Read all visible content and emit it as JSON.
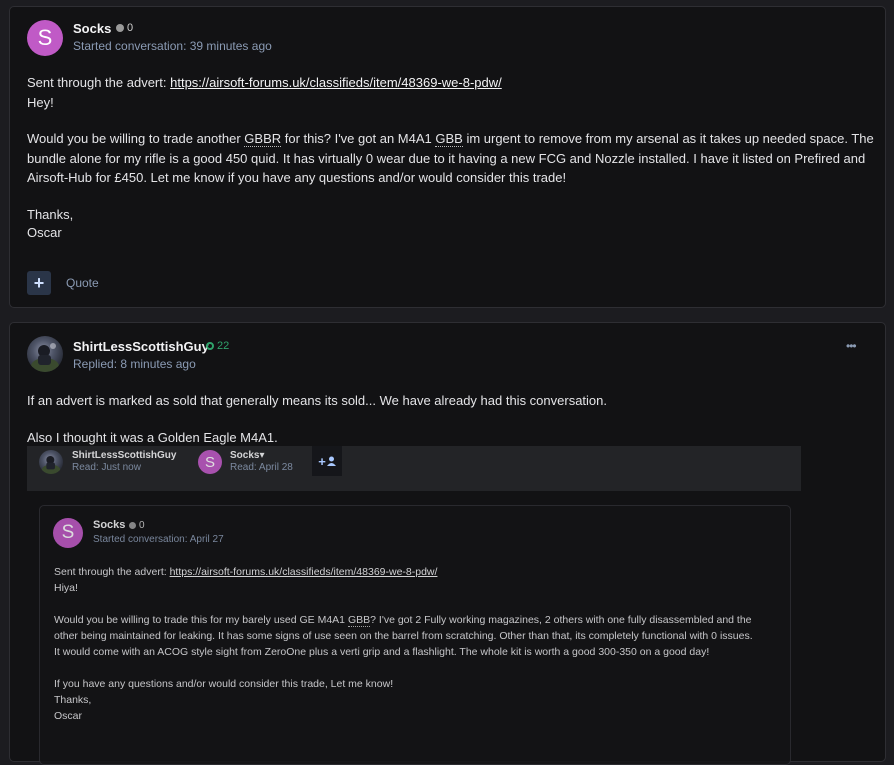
{
  "message1": {
    "author": "Socks",
    "avatar_letter": "S",
    "reputation": "0",
    "meta": "Started conversation: 39 minutes ago",
    "advert_prefix": "Sent through the advert: ",
    "advert_link": "https://airsoft-forums.uk/classifieds/item/48369-we-8-pdw/",
    "greeting": "Hey!",
    "p1_a": "Would you be willing to trade another ",
    "p1_gbbr": "GBBR",
    "p1_b": " for this? I've got an M4A1 ",
    "p1_gbb": "GBB",
    "p1_c": " im urgent to remove from my arsenal as it takes up needed space. The",
    "p1_line2": "bundle alone for my rifle is a good 450 quid. It has virtually 0 wear due to it having a new FCG and Nozzle installed. I have it listed on Prefired and",
    "p1_line3": "Airsoft-Hub for £450. Let me know if you have any questions and/or would consider this trade!",
    "thanks": "Thanks,",
    "sign": "Oscar",
    "plus_label": "+",
    "quote_label": "Quote"
  },
  "message2": {
    "author": "ShirtLessScottishGuy",
    "reputation": "22",
    "meta": "Replied: 8 minutes ago",
    "line1": "If an advert is marked as sold that generally means its sold... We have already had this conversation.",
    "line2": "Also I thought it was a Golden Eagle M4A1.",
    "more_label": "•••"
  },
  "read_receipts": {
    "user1_name": "ShirtLessScottishGuy",
    "user1_status": "Read: Just now",
    "user2_letter": "S",
    "user2_name": "Socks",
    "user2_caret": "▾",
    "user2_status": "Read: April 28",
    "add_label": "+"
  },
  "quoted": {
    "author": "Socks",
    "avatar_letter": "S",
    "reputation": "0",
    "meta": "Started conversation: April 27",
    "advert_prefix": "Sent through the advert: ",
    "advert_link": "https://airsoft-forums.uk/classifieds/item/48369-we-8-pdw/",
    "greeting": "Hiya!",
    "p1_a": "Would you be willing to trade this for my barely used GE M4A1 ",
    "p1_gbb": "GBB",
    "p1_b": "? I've got 2 Fully working magazines, 2 others with one fully disassembled and the",
    "p1_line2": "other being maintained for leaking. It has some signs of use seen on the barrel from scratching. Other than that, its completely functional with 0 issues.",
    "p1_line3": "It would come with an ACOG style sight from ZeroOne plus a verti grip and a flashlight. The whole kit is worth a good 300-350 on a good day!",
    "p2": "If you have any questions and/or would consider this trade, Let me know!",
    "thanks": "Thanks,",
    "sign": "Oscar"
  },
  "colors": {
    "avatar_purple": "#c05ac6",
    "meta_blue": "#8b9bb4",
    "rep_green": "#2fa36b",
    "rep_grey": "#9a9a9a"
  }
}
